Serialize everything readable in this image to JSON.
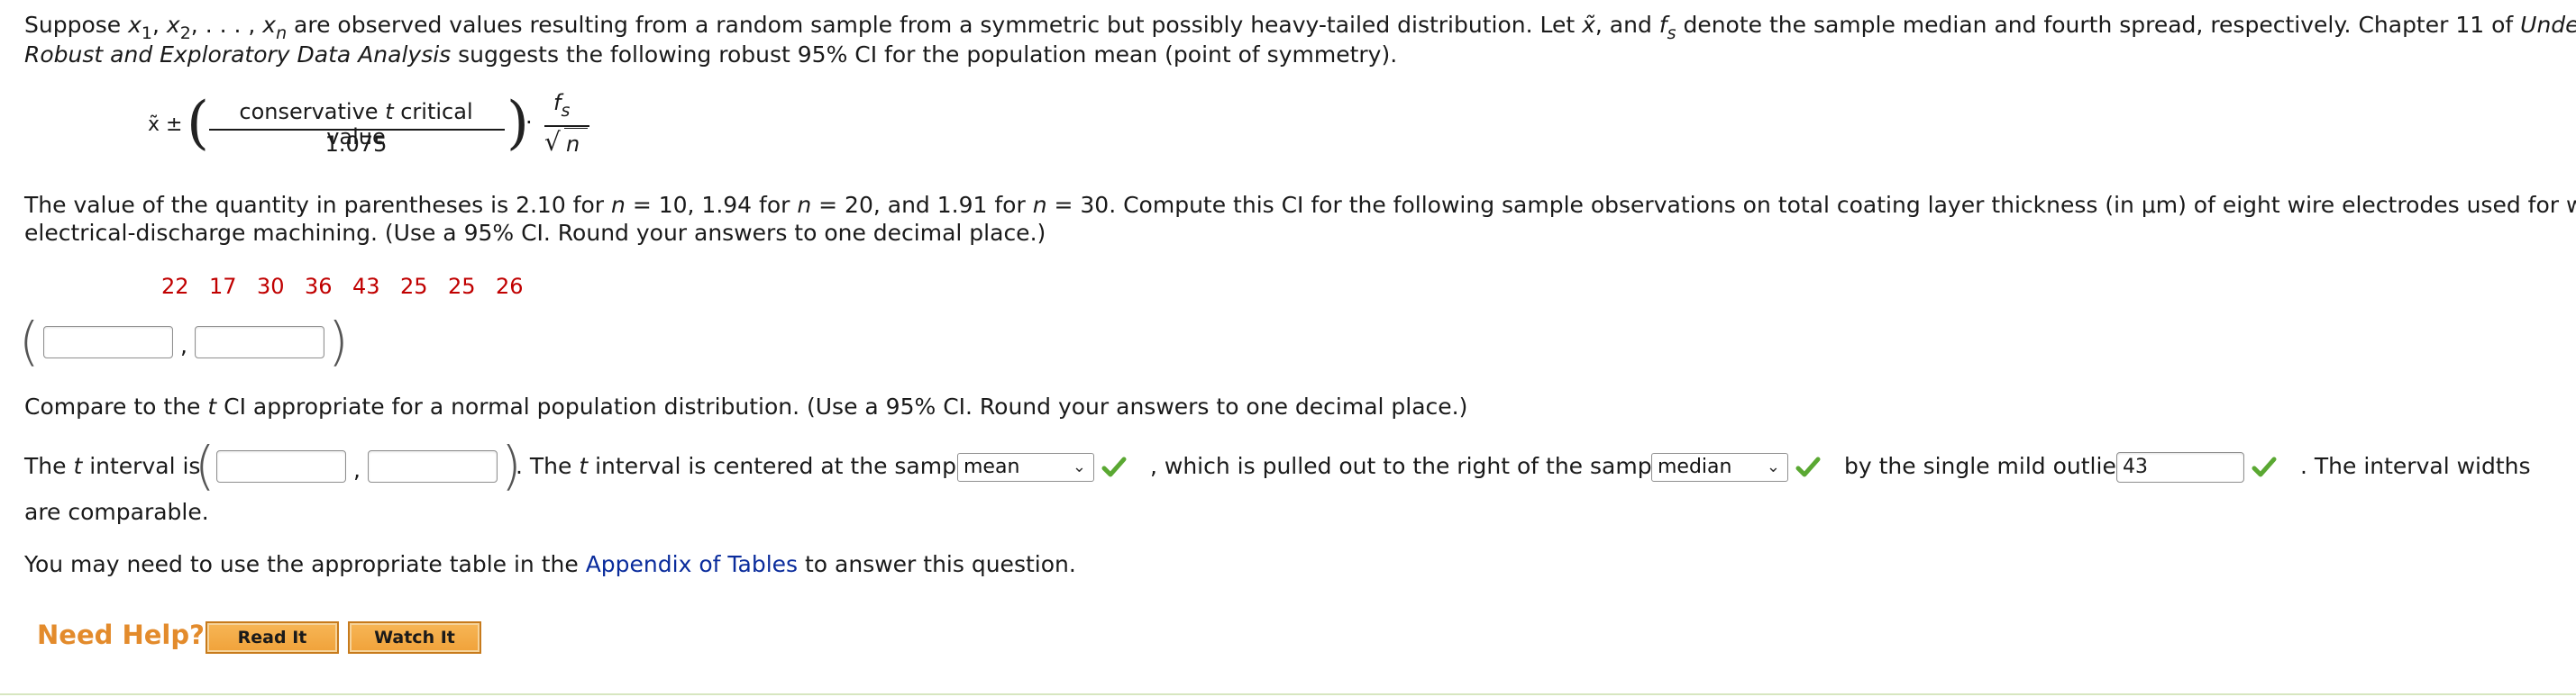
{
  "para1": {
    "part1": "Suppose ",
    "x": "x",
    "sub1": "1",
    "comma1": ", ",
    "sub2": "2",
    "ellipsis": ", . . . , ",
    "subn": "n",
    "part2": " are observed values resulting from a random sample from a symmetric but possibly heavy-tailed distribution. Let ",
    "xtilde": "x̃",
    "part3": ", and ",
    "f": "f",
    "subs": "s",
    "part4": " denote the sample median and fourth spread, respectively. Chapter 11 of ",
    "book_title_1": "Understanding",
    "book_title_2": "Robust and Exploratory Data Analysis",
    "part5": " suggests the following robust 95% CI for the population mean (point of symmetry)."
  },
  "formula": {
    "xtilde_pm": "x̃ ±",
    "numerator_a": "conservative ",
    "numerator_t": "t",
    "numerator_b": " critical value",
    "denominator": "1.075",
    "dot": "·",
    "fs_f": "f",
    "fs_s": "s",
    "sqrt": "√",
    "n": "n"
  },
  "para2": {
    "line1_a": "The value of the quantity in parentheses is 2.10 for ",
    "n1": "n",
    "line1_b": " = 10, 1.94 for ",
    "n2": "n",
    "line1_c": " = 20, and 1.91 for ",
    "n3": "n",
    "line1_d": " = 30. Compute this CI for the following sample observations on total coating layer thickness (in μm) of eight wire electrodes used for wire",
    "line2": "electrical-discharge machining. (Use a 95% CI. Round your answers to one decimal place.)"
  },
  "data_values": [
    "22",
    "17",
    "30",
    "36",
    "43",
    "25",
    "25",
    "26"
  ],
  "ci1": {
    "separator": ","
  },
  "para3": {
    "a": "Compare to the ",
    "t": "t",
    "b": " CI appropriate for a normal population distribution. (Use a 95% CI. Round your answers to one decimal place.)"
  },
  "t_interval_line": {
    "a": "The ",
    "t1": "t",
    "b": " interval is",
    "separator": ",",
    "c": ". The ",
    "t2": "t",
    "d": " interval is centered at the sample",
    "select1": "mean",
    "e": ", which is pulled out to the right of the sample",
    "select2": "median",
    "f": "by the single mild outlier",
    "outlier_value": "43",
    "g": ". The interval widths",
    "line2": "are comparable."
  },
  "para4": {
    "a": "You may need to use the appropriate table in the ",
    "link": "Appendix of Tables",
    "b": " to answer this question."
  },
  "help": {
    "label": "Need Help?",
    "read_it": "Read It",
    "watch_it": "Watch It"
  },
  "colors": {
    "data_red": "#c00000",
    "link_blue": "#0a2c9c",
    "check_green": "#5aa832",
    "help_orange": "#e38b2c"
  }
}
